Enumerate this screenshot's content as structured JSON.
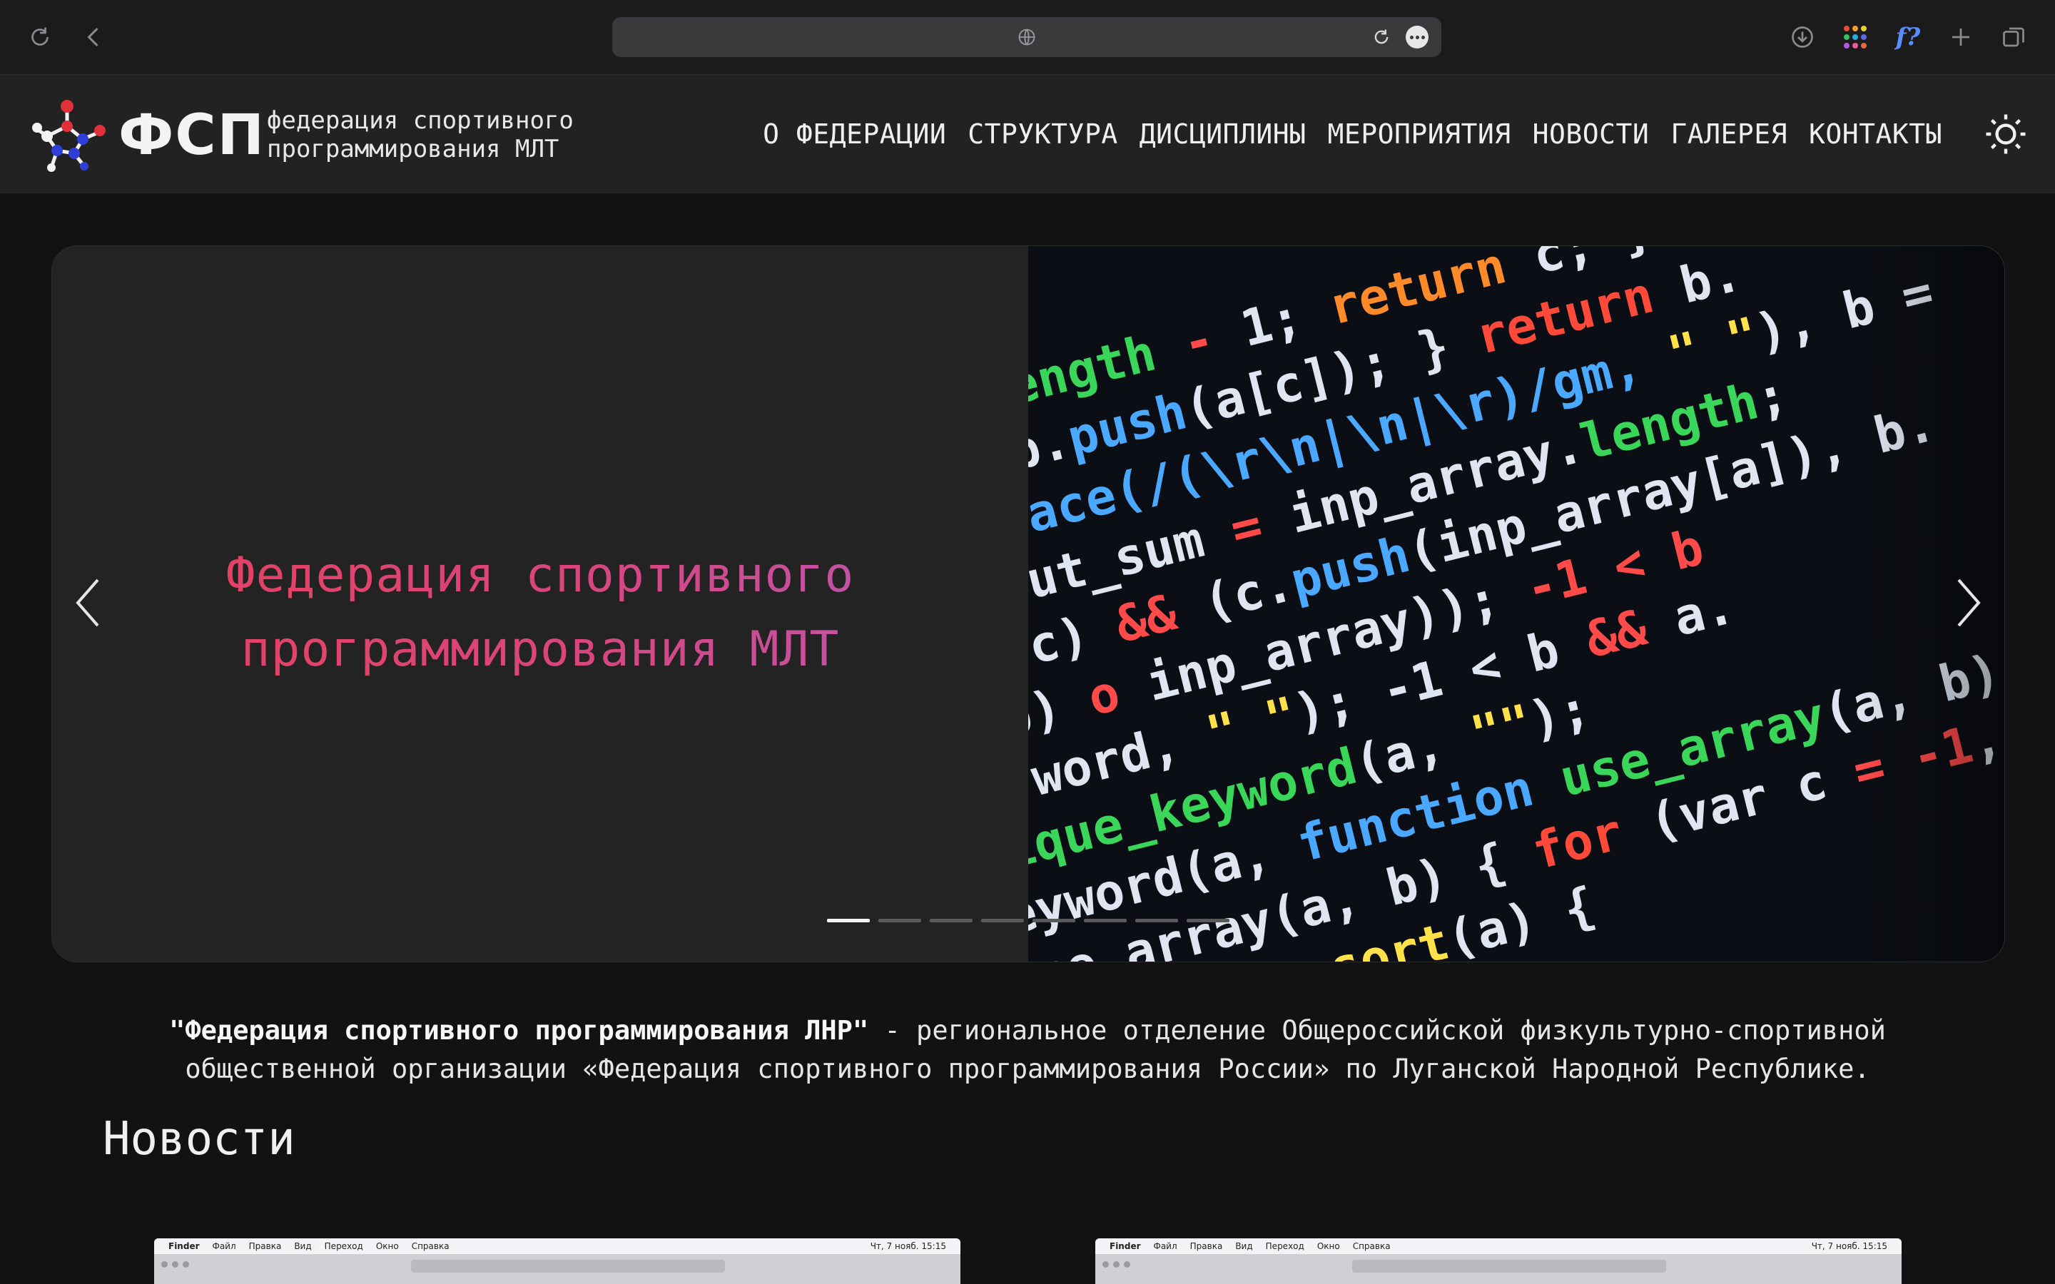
{
  "browser": {
    "url_display": "",
    "icons": [
      "reload-icon",
      "back-icon",
      "globe-icon",
      "page-reload-icon",
      "more-icon",
      "download-icon",
      "apps-icon",
      "formula-icon",
      "new-tab-icon",
      "tabs-icon"
    ],
    "formula_label": "f?"
  },
  "header": {
    "logo_text": "ФСП",
    "logo_subtitle_line1": "федерация спортивного",
    "logo_subtitle_line2": "программирования МЛТ",
    "nav": [
      {
        "label": "О ФЕДЕРАЦИИ"
      },
      {
        "label": "СТРУКТУРА"
      },
      {
        "label": "ДИСЦИПЛИНЫ"
      },
      {
        "label": "МЕРОПРИЯТИЯ"
      },
      {
        "label": "НОВОСТИ"
      },
      {
        "label": "ГАЛЕРЕЯ"
      },
      {
        "label": "КОНТАКТЫ"
      }
    ],
    "theme_icon": "sun-icon"
  },
  "hero": {
    "title_line1": "Федерация спортивного",
    "title_line2": "программирования МЛТ",
    "slide_count": 8,
    "active_slide": 1,
    "image_alt": "code-screen-photo"
  },
  "intro": {
    "bold": "\"Федерация спортивного программирования ЛНР\"",
    "rest_line1": " - региональное отделение Общероссийской физкультурно-спортивной",
    "line2": "общественной организации «Федерация спортивного программирования России» по Луганской Народной Республике."
  },
  "news": {
    "heading": "Новости",
    "cards": [
      {
        "menubar": [
          "Finder",
          "Файл",
          "Правка",
          "Вид",
          "Переход",
          "Окно",
          "Справка"
        ],
        "clock": "Чт, 7 нояб. 15:15"
      },
      {
        "menubar": [
          "Finder",
          "Файл",
          "Правка",
          "Вид",
          "Переход",
          "Окно",
          "Справка"
        ],
        "clock": "Чт, 7 нояб. 15:15"
      }
    ]
  },
  "colors": {
    "page_bg": "#121213",
    "header_bg": "#222223",
    "hero_gradient_start": "#e8405a",
    "hero_gradient_end": "#b45ab8",
    "logo_red": "#e0303a",
    "logo_blue": "#2d3fd8"
  }
}
